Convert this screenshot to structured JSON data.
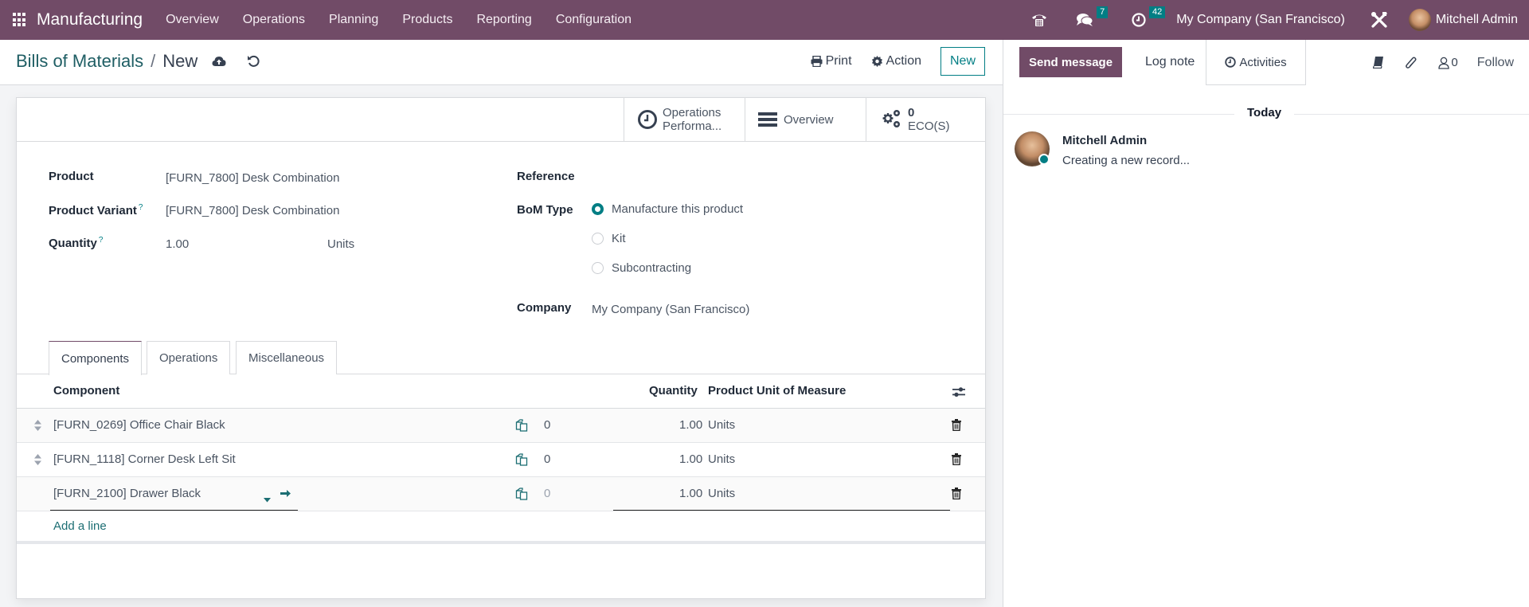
{
  "navbar": {
    "app_name": "Manufacturing",
    "menu": [
      "Overview",
      "Operations",
      "Planning",
      "Products",
      "Reporting",
      "Configuration"
    ],
    "messages_count": "7",
    "activities_count": "42",
    "company": "My Company (San Francisco)",
    "user": "Mitchell Admin"
  },
  "control": {
    "breadcrumb_parent": "Bills of Materials",
    "breadcrumb_separator": "/",
    "breadcrumb_current": "New",
    "print_label": "Print",
    "action_label": "Action",
    "new_label": "New"
  },
  "smart_buttons": {
    "operations_performance_line1": "Operations",
    "operations_performance_line2": "Performa...",
    "overview": "Overview",
    "eco_count": "0",
    "eco_label": "ECO(S)"
  },
  "form": {
    "product_label": "Product",
    "product_value": "[FURN_7800] Desk Combination",
    "variant_label": "Product Variant",
    "variant_value": "[FURN_7800] Desk Combination",
    "quantity_label": "Quantity",
    "quantity_value": "1.00",
    "quantity_uom": "Units",
    "help_mark": "?",
    "reference_label": "Reference",
    "reference_value": "",
    "bom_type_label": "BoM Type",
    "bom_type_options": [
      "Manufacture this product",
      "Kit",
      "Subcontracting"
    ],
    "bom_type_selected": "Manufacture this product",
    "company_label": "Company",
    "company_value": "My Company (San Francisco)"
  },
  "tabs": [
    "Components",
    "Operations",
    "Miscellaneous"
  ],
  "active_tab": "Components",
  "components_table": {
    "headers": {
      "component": "Component",
      "quantity": "Quantity",
      "uom": "Product Unit of Measure"
    },
    "rows": [
      {
        "component": "[FURN_0269] Office Chair Black",
        "forecast": "0",
        "quantity": "1.00",
        "uom": "Units"
      },
      {
        "component": "[FURN_1118] Corner Desk Left Sit",
        "forecast": "0",
        "quantity": "1.00",
        "uom": "Units"
      },
      {
        "component": "[FURN_2100] Drawer Black",
        "forecast": "0",
        "quantity": "1.00",
        "uom": "Units"
      }
    ],
    "add_line": "Add a line"
  },
  "chatter": {
    "send_message": "Send message",
    "log_note": "Log note",
    "activities": "Activities",
    "followers_count": "0",
    "follow": "Follow",
    "date_separator": "Today",
    "messages": [
      {
        "author": "Mitchell Admin",
        "body": "Creating a new record..."
      }
    ]
  },
  "colors": {
    "brand": "#714b67",
    "accent": "#017e84"
  }
}
